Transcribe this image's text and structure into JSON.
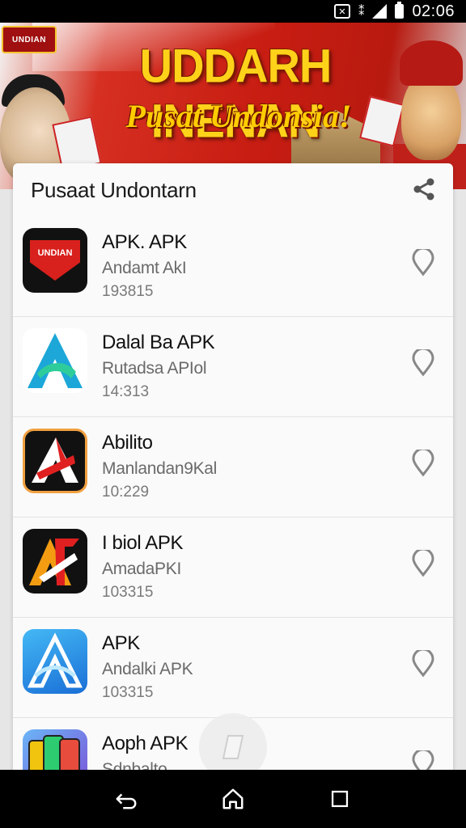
{
  "status_bar": {
    "time": "02:06",
    "icons": [
      "notification-box-icon",
      "sim-icon",
      "signal-icon",
      "battery-icon"
    ]
  },
  "banner": {
    "logo_text": "UNDIAN",
    "title": "UDDARH INENAN",
    "subtitle": "Pusat Undonsia!"
  },
  "card": {
    "title": "Pusaat Undontarn",
    "share_icon": "share-icon"
  },
  "apps": [
    {
      "name": "APK. APK",
      "developer": "Andamt AkI",
      "size": "193815",
      "icon": "shield-logo-icon"
    },
    {
      "name": "Dalal Ba APK",
      "developer": "Rutadsa APIol",
      "size": "14:313",
      "icon": "letter-a-blue-icon"
    },
    {
      "name": "Abilito",
      "developer": "Manlandan9Kal",
      "size": "10:229",
      "icon": "letter-a-red-icon"
    },
    {
      "name": "I biol APK",
      "developer": "AmadaPKI",
      "size": "103315",
      "icon": "letter-a-orange-icon"
    },
    {
      "name": "APK",
      "developer": "Andalki APK",
      "size": "103315",
      "icon": "letter-a-white-icon"
    },
    {
      "name": "Aoph APK",
      "developer": "Sdnbalto",
      "size": "",
      "icon": "phones-icon"
    }
  ],
  "colors": {
    "banner_red": "#c81d12",
    "banner_gold": "#ffd21a",
    "card_bg": "#fafafa",
    "nav_bg": "#000000"
  }
}
